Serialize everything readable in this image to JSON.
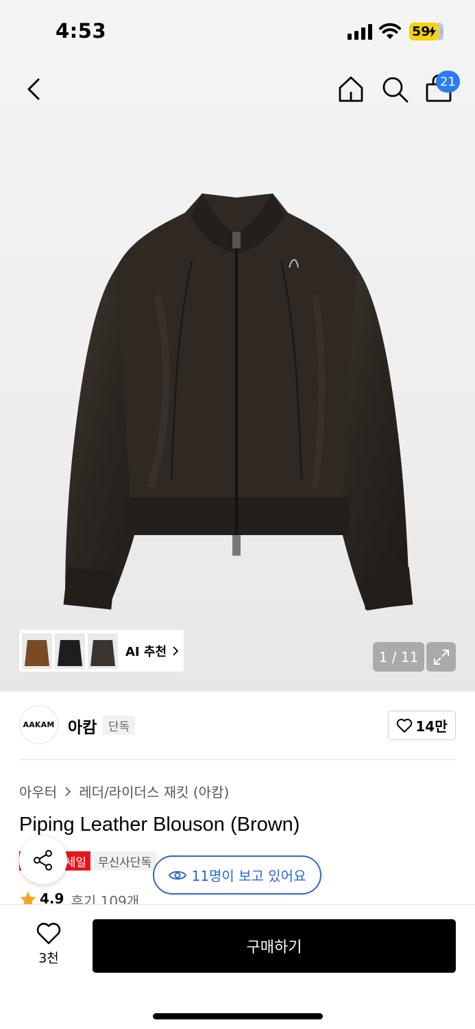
{
  "status_bar": {
    "time": "4:53",
    "battery": "59",
    "icons": [
      "signal-icon",
      "wifi-icon",
      "battery-charging-icon"
    ]
  },
  "nav": {
    "icons": [
      "back-icon",
      "home-icon",
      "search-icon",
      "bag-icon"
    ],
    "cart_count": "21"
  },
  "gallery": {
    "ai_label": "AI 추천",
    "counter": "1 / 11"
  },
  "brand": {
    "logo_text": "AAKAM",
    "name": "아캄",
    "tag": "단독",
    "likes": "14만"
  },
  "product": {
    "breadcrumb": [
      "아우터",
      "레더/라이더스 재킷 (아캄)"
    ],
    "title": "Piping Leather Blouson (Brown)",
    "tags": [
      "세일",
      "무신사단독"
    ],
    "viewers": "11명이 보고 있어요",
    "rating": "4.9",
    "reviews": "후기 109개"
  },
  "bottom": {
    "wish_count": "3천",
    "buy_label": "구매하기"
  },
  "colors": {
    "accent_blue": "#2a66d6",
    "badge_blue": "#2a7cf6",
    "sale_red": "#e8141c",
    "star": "#f5a623",
    "battery_yellow": "#f5d20a"
  }
}
